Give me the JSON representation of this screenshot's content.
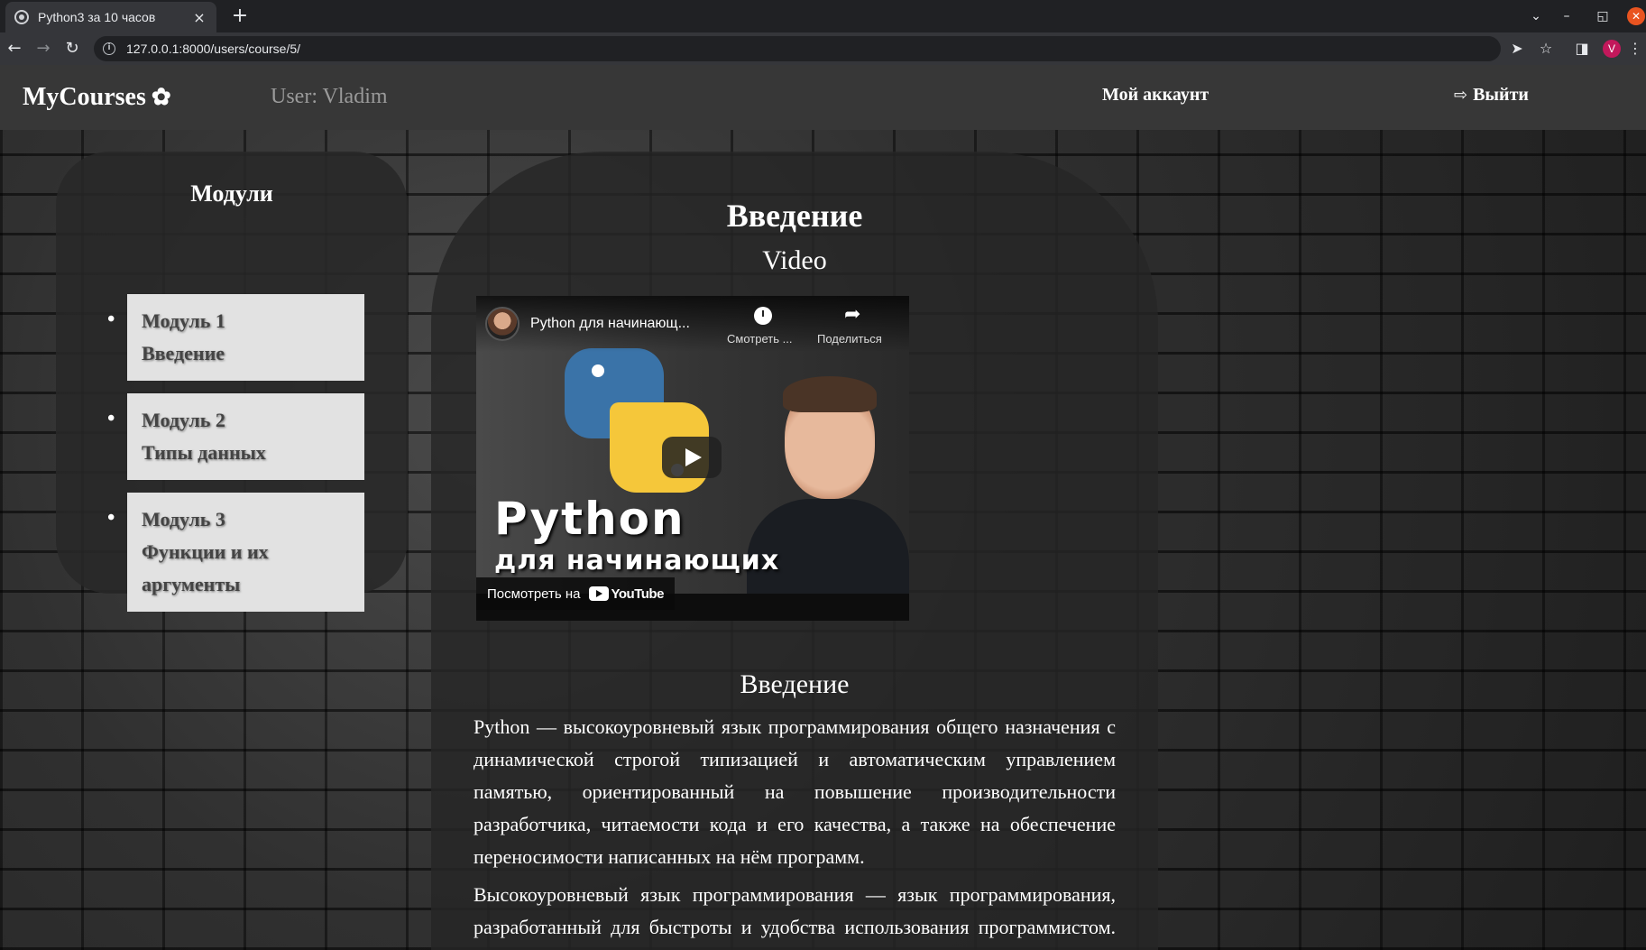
{
  "browser": {
    "tab_title": "Python3 за 10 часов",
    "tab_close": "×",
    "new_tab": "+",
    "url": "127.0.0.1:8000/users/course/5/",
    "profile_initial": "V"
  },
  "navbar": {
    "brand": "MyCourses",
    "user_label": "User: Vladim",
    "account_link": "Мой аккаунт",
    "logout_link": "Выйти"
  },
  "sidebar": {
    "title": "Модули",
    "modules": [
      {
        "label": "Модуль 1",
        "name": "Введение"
      },
      {
        "label": "Модуль 2",
        "name": "Типы данных"
      },
      {
        "label": "Модуль 3",
        "name": "Функции и их аргументы"
      }
    ]
  },
  "main": {
    "title": "Введение",
    "video_label": "Video",
    "video": {
      "title": "Python для начинающ...",
      "watch_later": "Смотреть ...",
      "share": "Поделиться",
      "thumb_title": "Python",
      "thumb_subtitle": "для начинающих",
      "watch_on": "Посмотреть на",
      "youtube": "YouTube"
    },
    "section_title": "Введение",
    "paragraphs": [
      "Python — высокоуровневый язык программирования общего назначения с динамической строгой типизацией и автоматическим управлением памятью, ориентированный на повышение производительности разработчика, читаемости кода и его качества, а также на обеспечение переносимости написанных на нём программ.",
      "Высокоуровневый язык программирования — язык программирования, разработанный для быстроты и удобства использования программистом. Основная черта высокоуровневых"
    ]
  }
}
